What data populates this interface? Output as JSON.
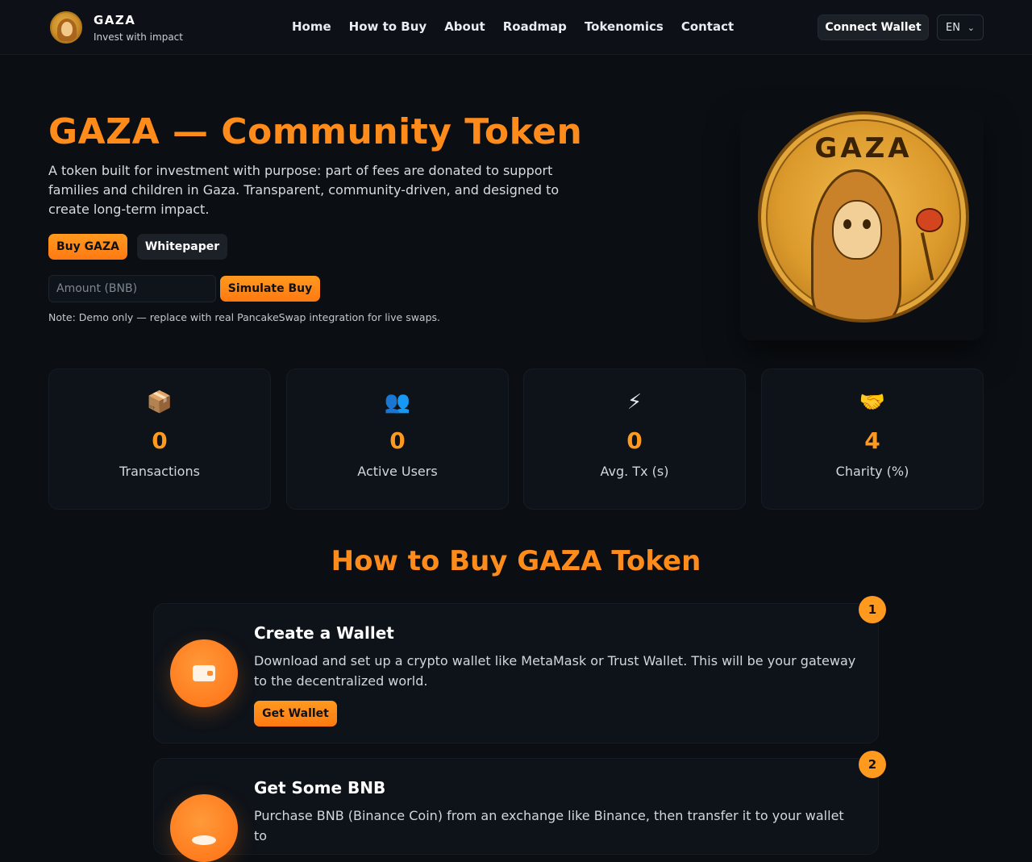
{
  "header": {
    "brand_name": "GAZA",
    "brand_tagline": "Invest with impact",
    "nav": [
      {
        "label": "Home"
      },
      {
        "label": "How to Buy"
      },
      {
        "label": "About"
      },
      {
        "label": "Roadmap"
      },
      {
        "label": "Tokenomics"
      },
      {
        "label": "Contact"
      }
    ],
    "connect_wallet_label": "Connect Wallet",
    "language": "EN"
  },
  "hero": {
    "title": "GAZA — Community Token",
    "description": "A token built for investment with purpose: part of fees are donated to support families and children in Gaza. Transparent, community-driven, and designed to create long-term impact.",
    "buy_label": "Buy GAZA",
    "whitepaper_label": "Whitepaper",
    "amount_placeholder": "Amount (BNB)",
    "simulate_label": "Simulate Buy",
    "note": "Note: Demo only — replace with real PancakeSwap integration for live swaps.",
    "coin_text": "GAZA"
  },
  "stats": [
    {
      "icon": "package-icon",
      "glyph": "📦",
      "value": "0",
      "label": "Transactions"
    },
    {
      "icon": "users-icon",
      "glyph": "👥",
      "value": "0",
      "label": "Active Users"
    },
    {
      "icon": "lightning-icon",
      "glyph": "⚡",
      "value": "0",
      "label": "Avg. Tx (s)"
    },
    {
      "icon": "handshake-icon",
      "glyph": "🤝",
      "value": "4",
      "label": "Charity (%)"
    }
  ],
  "how_to_buy": {
    "title": "How to Buy GAZA Token",
    "steps": [
      {
        "number": "1",
        "icon": "wallet-icon",
        "title": "Create a Wallet",
        "description": "Download and set up a crypto wallet like MetaMask or Trust Wallet. This will be your gateway to the decentralized world.",
        "button_label": "Get Wallet"
      },
      {
        "number": "2",
        "icon": "coins-icon",
        "title": "Get Some BNB",
        "description": "Purchase BNB (Binance Coin) from an exchange like Binance, then transfer it to your wallet to"
      }
    ]
  },
  "colors": {
    "accent": "#ff8c1a",
    "background": "#0b0f14",
    "card": "#0e1319"
  }
}
